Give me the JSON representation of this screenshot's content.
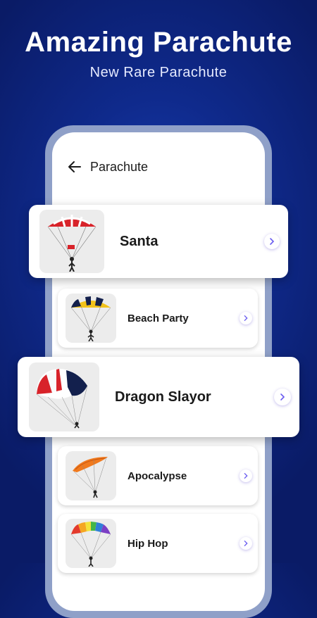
{
  "promo": {
    "headline": "Amazing Parachute",
    "subhead": "New Rare Parachute"
  },
  "appbar": {
    "title": "Parachute",
    "back_icon": "arrow-left-icon"
  },
  "items": [
    {
      "name": "Santa",
      "icon": "parachute-red-white-icon"
    },
    {
      "name": "Beach Party",
      "icon": "parachute-yellow-navy-icon"
    },
    {
      "name": "Dragon Slayor",
      "icon": "parachute-red-white-navy-icon"
    },
    {
      "name": "Apocalypse",
      "icon": "paraglider-orange-icon"
    },
    {
      "name": "Hip Hop",
      "icon": "parachute-rainbow-icon"
    }
  ],
  "colors": {
    "background": "#0f2a8c",
    "accent": "#6a5cf0",
    "frame": "#8fa0c8"
  }
}
